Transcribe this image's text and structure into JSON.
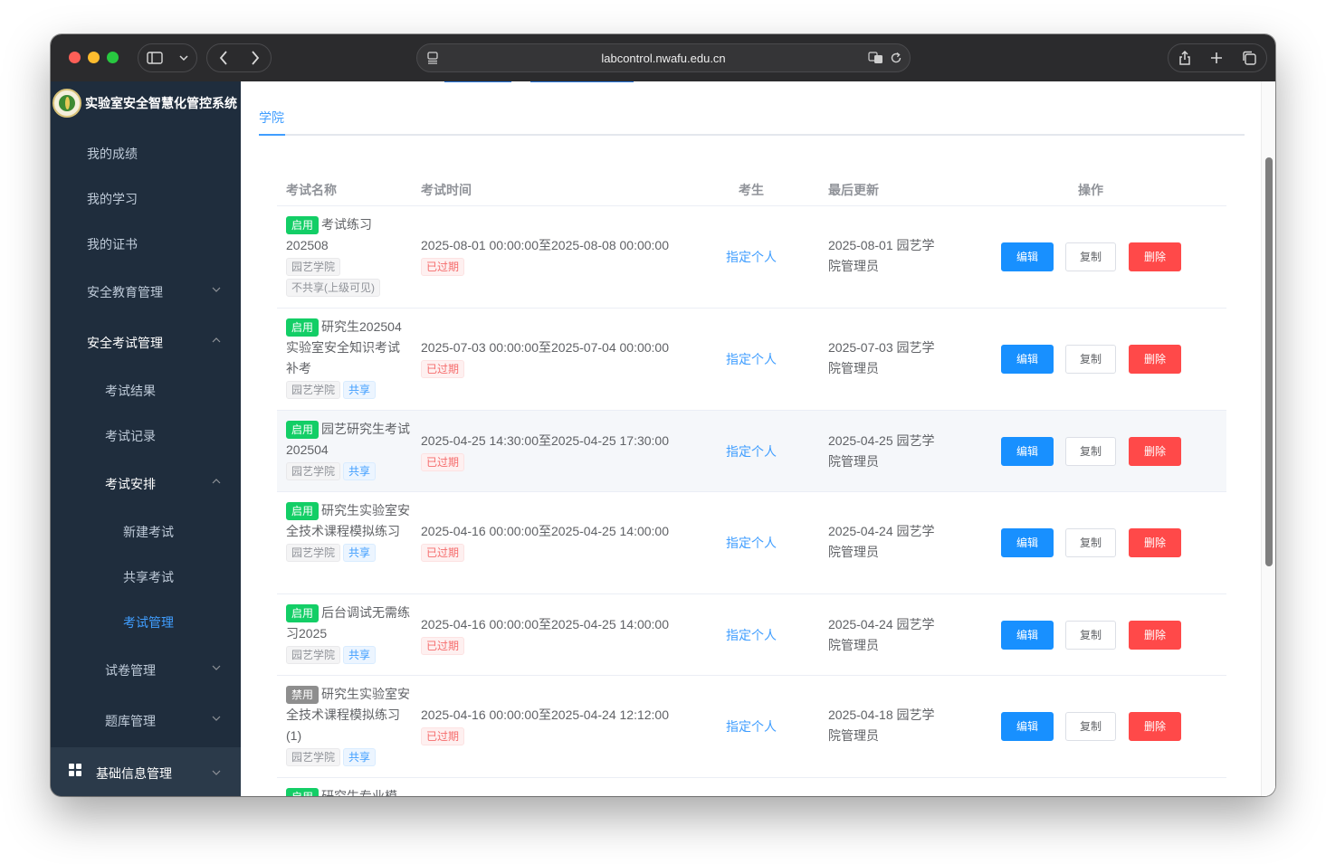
{
  "browser": {
    "url": "labcontrol.nwafu.edu.cn"
  },
  "app": {
    "title": "实验室安全智慧化管控系统"
  },
  "sidebar": {
    "items": [
      {
        "label": "我的成绩"
      },
      {
        "label": "我的学习"
      },
      {
        "label": "我的证书"
      },
      {
        "label": "安全教育管理"
      },
      {
        "label": "安全考试管理"
      },
      {
        "label": "考试结果"
      },
      {
        "label": "考试记录"
      },
      {
        "label": "考试安排"
      },
      {
        "label": "新建考试"
      },
      {
        "label": "共享考试"
      },
      {
        "label": "考试管理"
      },
      {
        "label": "试卷管理"
      },
      {
        "label": "题库管理"
      },
      {
        "label": "基础信息管理"
      }
    ]
  },
  "tabs": [
    {
      "label": "学院"
    }
  ],
  "table": {
    "columns": [
      "考试名称",
      "考试时间",
      "考生",
      "最后更新",
      "操作"
    ],
    "buttons": {
      "edit": "编辑",
      "copy": "复制",
      "delete": "删除"
    },
    "rows": [
      {
        "status": "启用",
        "name": "考试练习202508",
        "college": "园艺学院",
        "share": "不共享(上级可见)",
        "time": "2025-08-01 00:00:00至2025-08-08 00:00:00",
        "expired": "已过期",
        "examinee": "指定个人",
        "update": "2025-08-01 园艺学院管理员"
      },
      {
        "status": "启用",
        "name": "研究生202504实验室安全知识考试补考",
        "college": "园艺学院",
        "share": "共享",
        "time": "2025-07-03 00:00:00至2025-07-04 00:00:00",
        "expired": "已过期",
        "examinee": "指定个人",
        "update": "2025-07-03 园艺学院管理员"
      },
      {
        "status": "启用",
        "name": "园艺研究生考试202504",
        "college": "园艺学院",
        "share": "共享",
        "time": "2025-04-25 14:30:00至2025-04-25 17:30:00",
        "expired": "已过期",
        "examinee": "指定个人",
        "update": "2025-04-25 园艺学院管理员"
      },
      {
        "status": "启用",
        "name": "研究生实验室安全技术课程模拟练习",
        "college": "园艺学院",
        "share": "共享",
        "time": "2025-04-16 00:00:00至2025-04-25 14:00:00",
        "expired": "已过期",
        "examinee": "指定个人",
        "update": "2025-04-24 园艺学院管理员"
      },
      {
        "status": "启用",
        "name": "后台调试无需练习2025",
        "college": "园艺学院",
        "share": "共享",
        "time": "2025-04-16 00:00:00至2025-04-25 14:00:00",
        "expired": "已过期",
        "examinee": "指定个人",
        "update": "2025-04-24 园艺学院管理员"
      },
      {
        "status": "禁用",
        "name": "研究生实验室安全技术课程模拟练习(1)",
        "college": "园艺学院",
        "share": "共享",
        "time": "2025-04-16 00:00:00至2025-04-24 12:12:00",
        "expired": "已过期",
        "examinee": "指定个人",
        "update": "2025-04-18 园艺学院管理员"
      },
      {
        "status": "启用",
        "name": "研究生专业模"
      }
    ]
  },
  "colors": {
    "sidebar_bg": "#1f2d3d",
    "accent": "#409eff",
    "enabled": "#13ce66",
    "danger": "#ff4949"
  }
}
